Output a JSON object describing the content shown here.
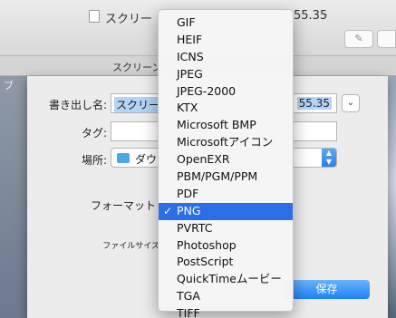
{
  "window": {
    "title_left": "スクリー",
    "title_right": "55.35",
    "title_chevron": "⌄",
    "tab_title": "スクリーン",
    "annotate_icon": "pen-icon"
  },
  "sheet": {
    "name_label": "書き出し名:",
    "name_value_left": "スクリー",
    "name_value_right": "55.35",
    "tags_label": "タグ:",
    "tags_value": "",
    "location_label": "場所:",
    "location_value": "ダウ",
    "format_label": "フォーマット",
    "filesize_label": "ファイルサイズ",
    "save_label": "保存",
    "expand_glyph": "⌄"
  },
  "format_menu": {
    "items": [
      {
        "label": "GIF"
      },
      {
        "label": "HEIF"
      },
      {
        "label": "ICNS"
      },
      {
        "label": "JPEG"
      },
      {
        "label": "JPEG-2000"
      },
      {
        "label": "KTX"
      },
      {
        "label": "Microsoft BMP"
      },
      {
        "label": "Microsoftアイコン"
      },
      {
        "label": "OpenEXR"
      },
      {
        "label": "PBM/PGM/PPM"
      },
      {
        "label": "PDF"
      },
      {
        "label": "PNG",
        "selected": true
      },
      {
        "label": "PVRTC"
      },
      {
        "label": "Photoshop"
      },
      {
        "label": "PostScript"
      },
      {
        "label": "QuickTimeムービー"
      },
      {
        "label": "TGA"
      },
      {
        "label": "TIFF"
      }
    ],
    "selected_value": "PNG",
    "check_glyph": "✓"
  }
}
